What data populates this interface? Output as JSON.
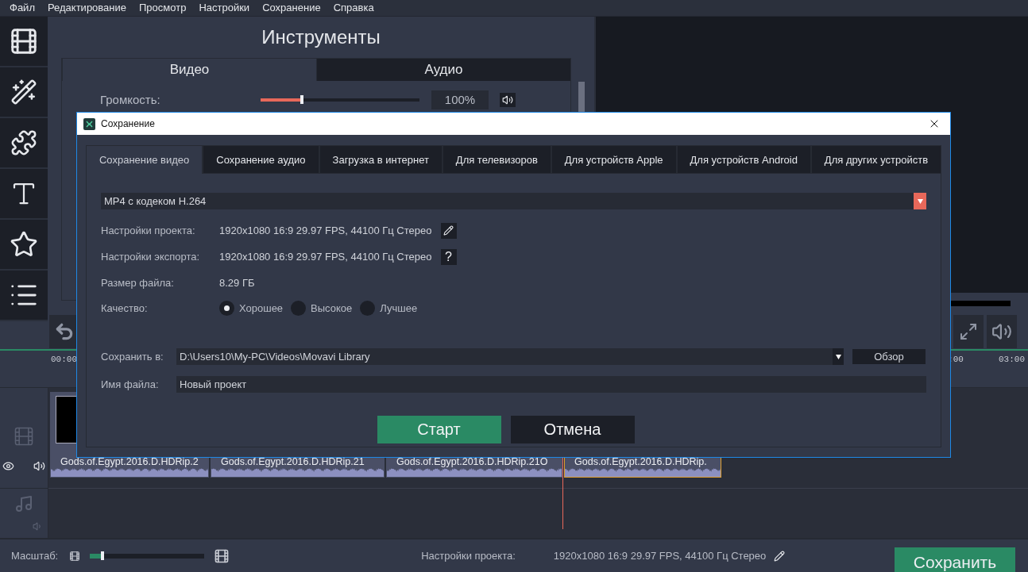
{
  "menu": [
    "Файл",
    "Редактирование",
    "Просмотр",
    "Настройки",
    "Сохранение",
    "Справка"
  ],
  "tools": {
    "title": "Инструменты",
    "tabs": [
      {
        "label": "Видео",
        "selected": true
      },
      {
        "label": "Аудио",
        "selected": false
      }
    ],
    "volume": {
      "label": "Громкость:",
      "level": 0.26,
      "reading": "100%"
    }
  },
  "timeline": {
    "ruler": [
      "00:00",
      ":00",
      "03:00"
    ],
    "clips": [
      {
        "label": "Gods.of.Egypt.2016.D.HDRip.2",
        "selected": false
      },
      {
        "label": "Gods.of.Egypt.2016.D.HDRip.21",
        "selected": false
      },
      {
        "label": "Gods.of.Egypt.2016.D.HDRip.21O",
        "selected": false
      },
      {
        "label": "Gods.of.Egypt.2016.D.HDRip.",
        "selected": true
      }
    ]
  },
  "bottom_bar": {
    "scale_label": "Масштаб:",
    "zoom": {
      "level": 0.11
    },
    "settings_label": "Настройки проекта:",
    "settings_value": "1920x1080 16:9 29.97 FPS, 44100 Гц Стерео",
    "save_button": "Сохранить"
  },
  "dialog": {
    "title": "Сохранение",
    "tabs": [
      {
        "label": "Сохранение видео",
        "selected": true
      },
      {
        "label": "Сохранение аудио",
        "selected": false
      },
      {
        "label": "Загрузка в интернет",
        "selected": false
      },
      {
        "label": "Для телевизоров",
        "selected": false
      },
      {
        "label": "Для устройств Apple",
        "selected": false
      },
      {
        "label": "Для устройств Android",
        "selected": false
      },
      {
        "label": "Для других устройств",
        "selected": false
      }
    ],
    "format": "MP4 с кодеком H.264",
    "rows": [
      {
        "label": "Настройки проекта:",
        "value": "1920x1080 16:9 29.97 FPS, 44100 Гц Стерео",
        "kind": "edit"
      },
      {
        "label": "Настройки экспорта:",
        "value": "1920x1080 16:9 29.97 FPS, 44100 Гц Стерео",
        "kind": "help",
        "button": "?"
      },
      {
        "label": "Размер файла:",
        "value": "8.29 ГБ",
        "kind": "plain"
      }
    ],
    "quality": {
      "label": "Качество:",
      "options": [
        {
          "label": "Хорошее",
          "selected": true
        },
        {
          "label": "Высокое",
          "selected": false
        },
        {
          "label": "Лучшее",
          "selected": false
        }
      ]
    },
    "save_to": {
      "label": "Сохранить в:",
      "value": "D:\\Users10\\My-PC\\Videos\\Movavi Library",
      "browse": "Обзор"
    },
    "file_name": {
      "label": "Имя файла:",
      "value": "Новый проект"
    },
    "start": "Старт",
    "cancel": "Отмена"
  }
}
